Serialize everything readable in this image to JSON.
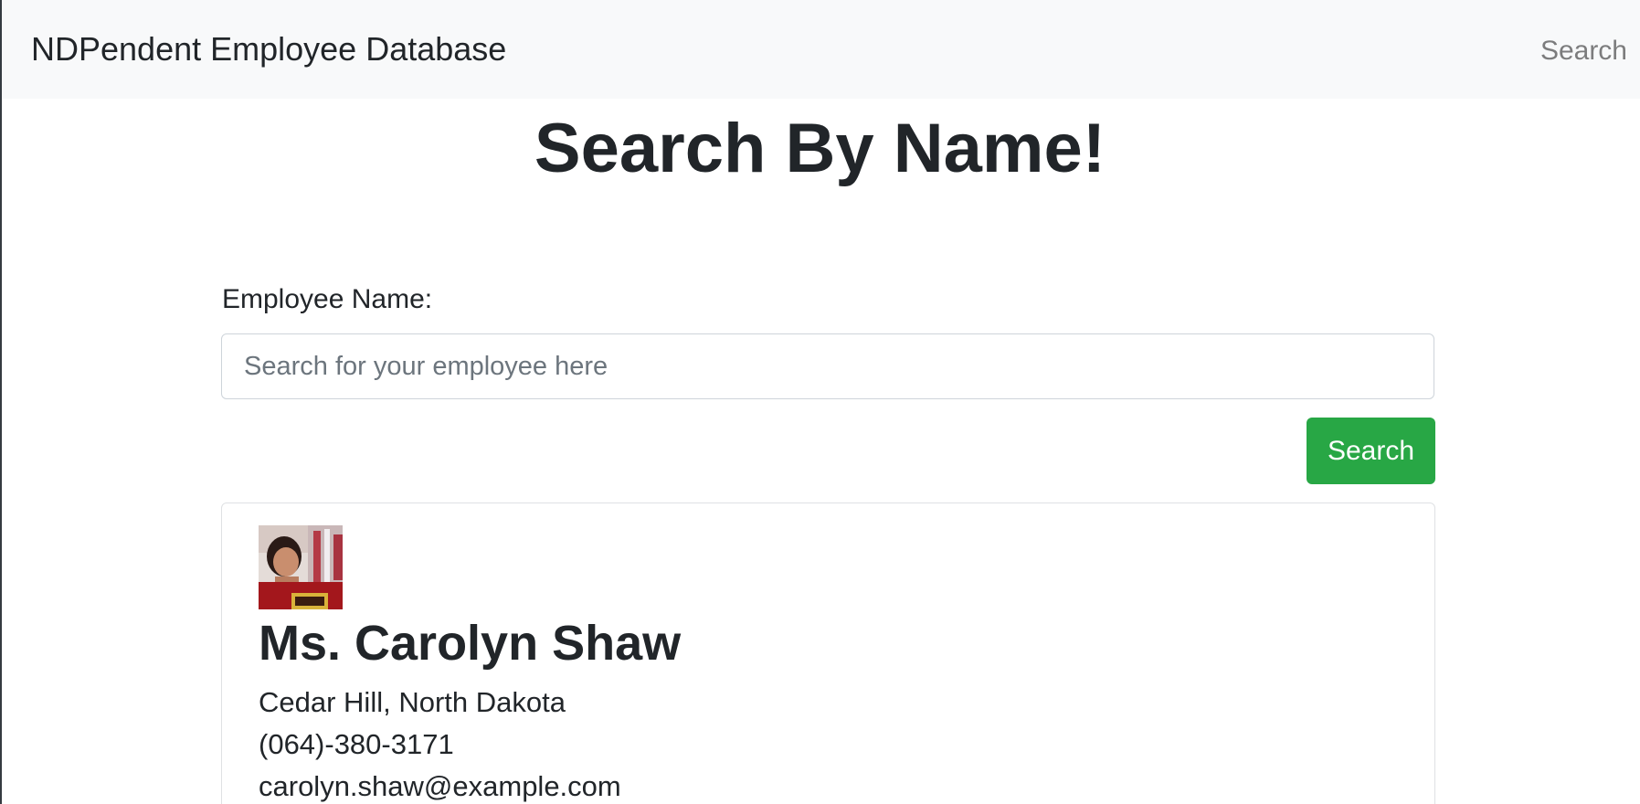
{
  "navbar": {
    "brand": "NDPendent Employee Database",
    "search_link": "Search"
  },
  "main": {
    "title": "Search By Name!",
    "form": {
      "label": "Employee Name:",
      "input_value": "",
      "input_placeholder": "Search for your employee here",
      "submit_label": "Search"
    }
  },
  "results": [
    {
      "name": "Ms. Carolyn Shaw",
      "location": "Cedar Hill, North Dakota",
      "phone": "(064)-380-3171",
      "email": "carolyn.shaw@example.com"
    }
  ],
  "colors": {
    "navbar_bg": "#f8f9fa",
    "primary_text": "#212529",
    "muted_link": "#7f7f7f",
    "button_success": "#28a745",
    "input_border": "#ced4da"
  }
}
